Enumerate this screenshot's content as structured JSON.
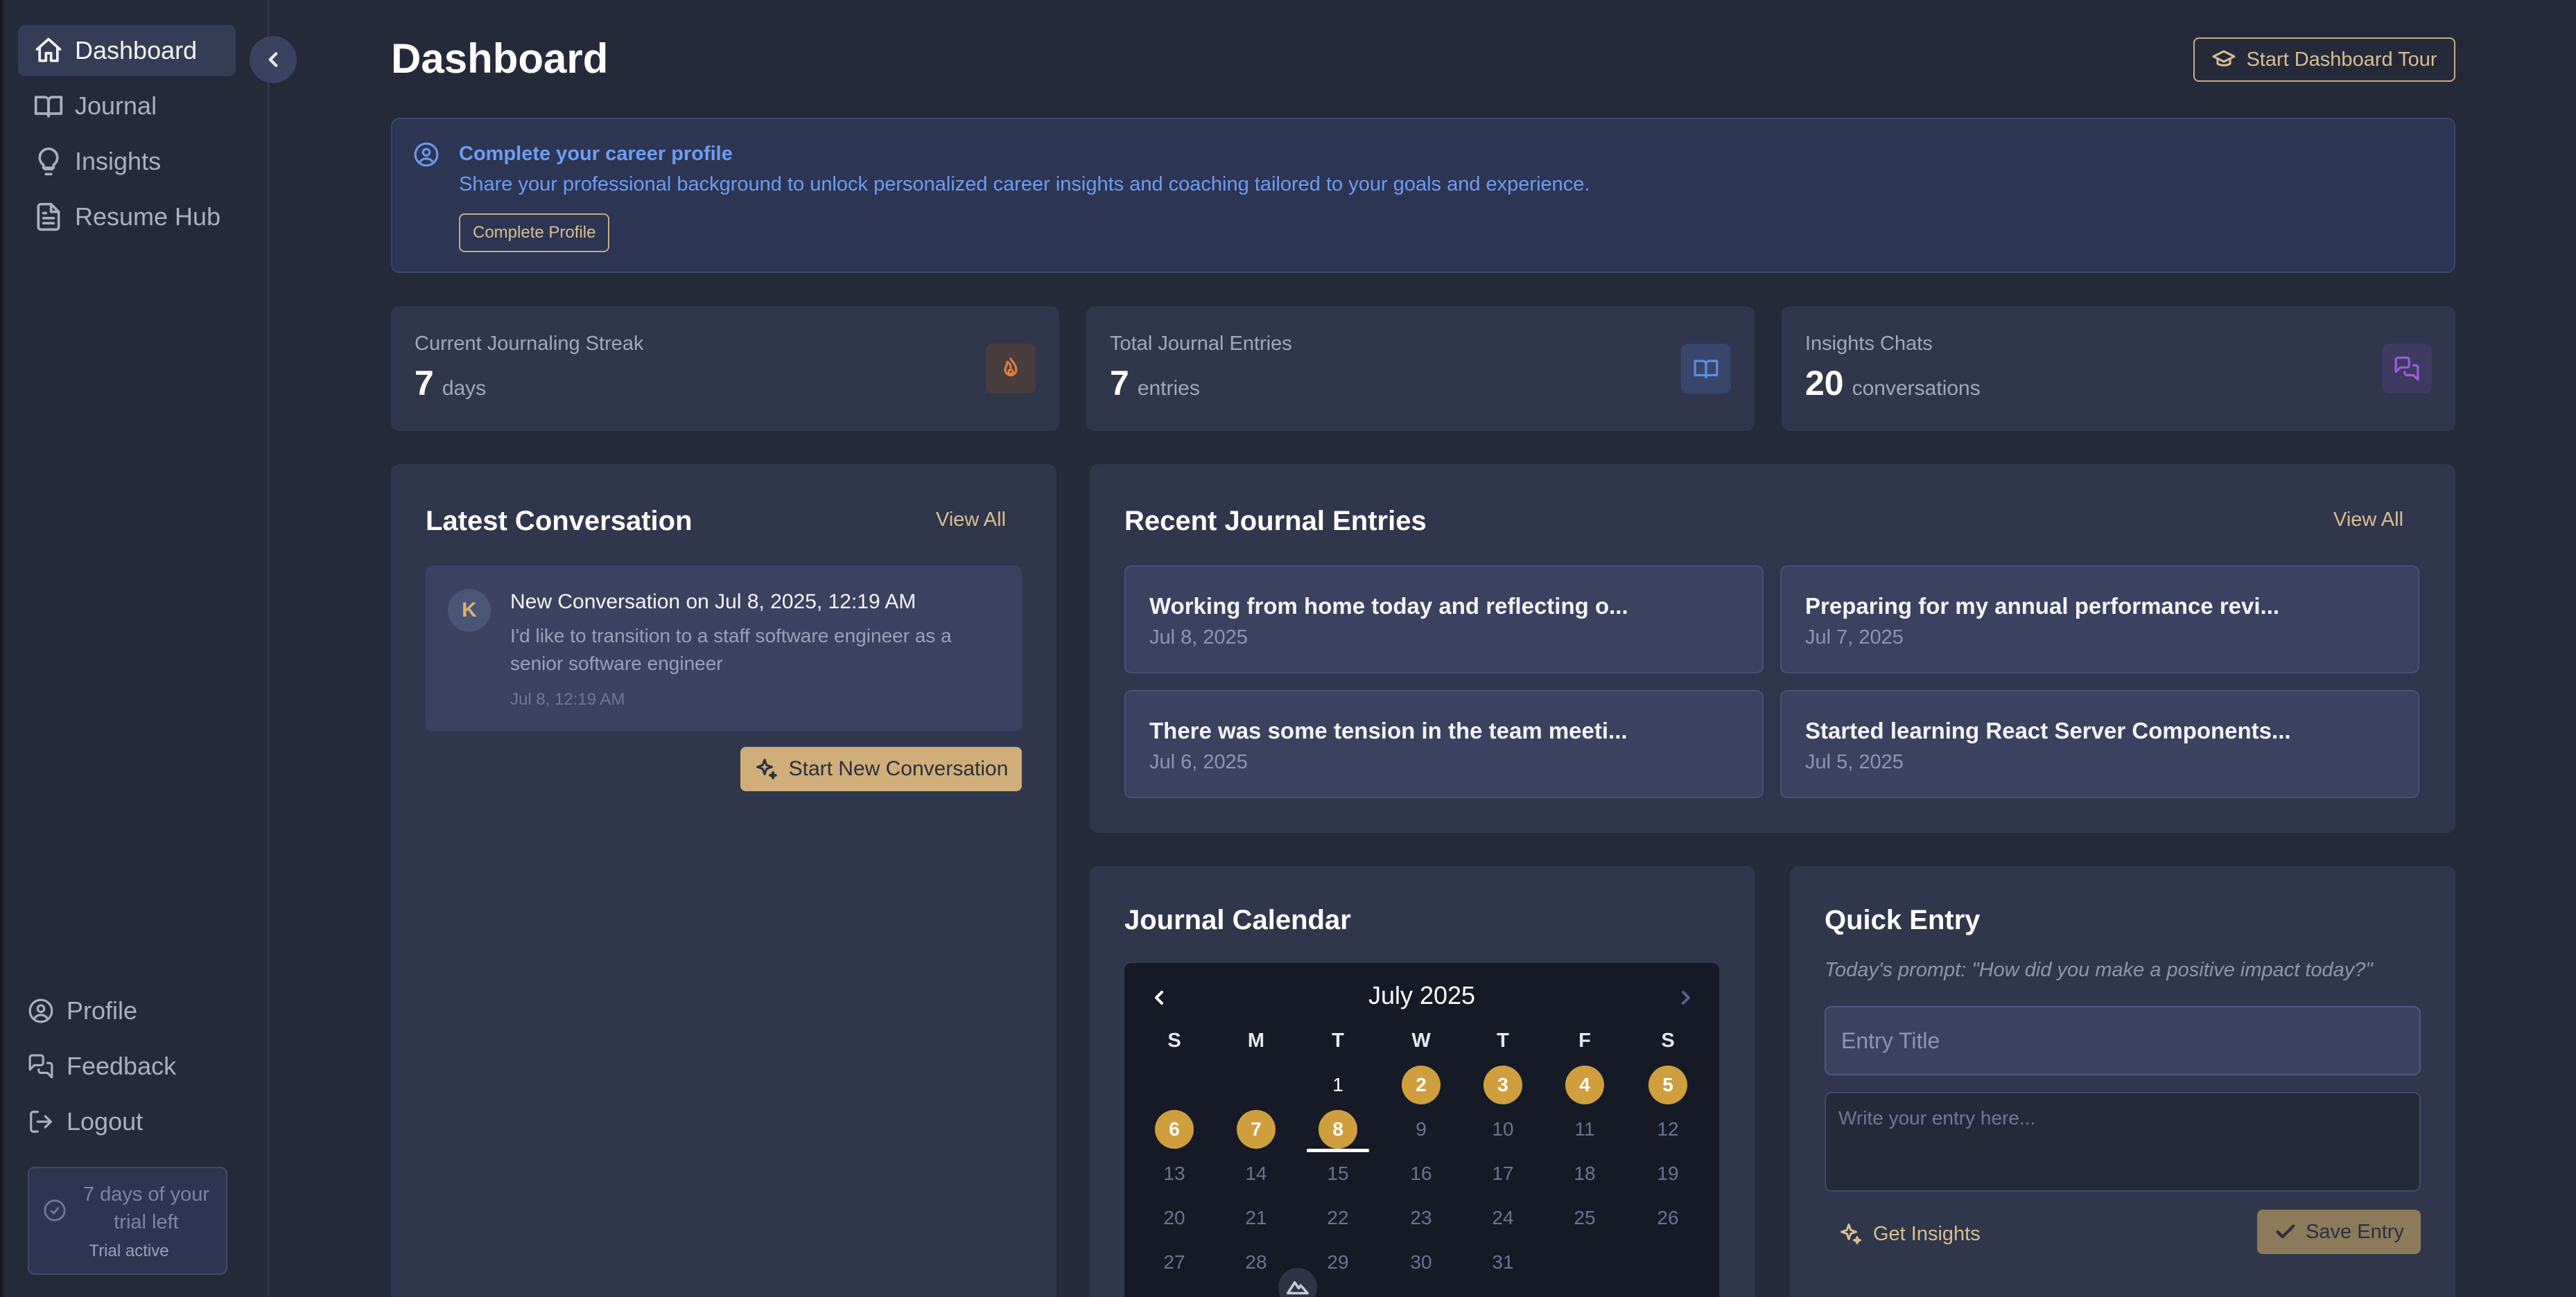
{
  "sidebar": {
    "nav": [
      {
        "label": "Dashboard",
        "icon": "home-icon",
        "active": true
      },
      {
        "label": "Journal",
        "icon": "book-icon",
        "active": false
      },
      {
        "label": "Insights",
        "icon": "lightbulb-icon",
        "active": false
      },
      {
        "label": "Resume Hub",
        "icon": "document-icon",
        "active": false
      }
    ],
    "bottom": [
      {
        "label": "Profile",
        "icon": "user-circle-icon"
      },
      {
        "label": "Feedback",
        "icon": "chat-bubbles-icon"
      },
      {
        "label": "Logout",
        "icon": "logout-icon"
      }
    ],
    "trial": {
      "text": "7 days of your trial left",
      "status": "Trial active"
    }
  },
  "header": {
    "title": "Dashboard",
    "tour_button": "Start Dashboard Tour"
  },
  "banner": {
    "title": "Complete your career profile",
    "description": "Share your professional background to unlock personalized career insights and coaching tailored to your goals and experience.",
    "button": "Complete Profile"
  },
  "stats": [
    {
      "label": "Current Journaling Streak",
      "value": "7",
      "unit": "days",
      "icon": "flame-icon",
      "color": "#e0803b",
      "bg": "#4a3d3e"
    },
    {
      "label": "Total Journal Entries",
      "value": "7",
      "unit": "entries",
      "icon": "book-icon",
      "color": "#5b8fe6",
      "bg": "#37466a"
    },
    {
      "label": "Insights Chats",
      "value": "20",
      "unit": "conversations",
      "icon": "chat-bubbles-icon",
      "color": "#a05ce0",
      "bg": "#3f3a60"
    }
  ],
  "latest_conversation": {
    "title": "Latest Conversation",
    "view_all": "View All",
    "avatar_letter": "K",
    "item": {
      "title": "New Conversation on Jul 8, 2025, 12:19 AM",
      "message": "I'd like to transition to a staff software engineer as a senior software engineer",
      "time": "Jul 8, 12:19 AM"
    },
    "new_button": "Start New Conversation"
  },
  "recent_entries": {
    "title": "Recent Journal Entries",
    "view_all": "View All",
    "entries": [
      {
        "title": "Working from home today and reflecting o...",
        "date": "Jul 8, 2025"
      },
      {
        "title": "Preparing for my annual performance revi...",
        "date": "Jul 7, 2025"
      },
      {
        "title": "There was some tension in the team meeti...",
        "date": "Jul 6, 2025"
      },
      {
        "title": "Started learning React Server Components...",
        "date": "Jul 5, 2025"
      }
    ]
  },
  "calendar": {
    "title": "Journal Calendar",
    "month": "July 2025",
    "weekdays": [
      "S",
      "M",
      "T",
      "W",
      "T",
      "F",
      "S"
    ],
    "first_weekday": 2,
    "days_in_month": 31,
    "entry_days": [
      2,
      3,
      4,
      5,
      6,
      7,
      8
    ],
    "today": 8,
    "accent": "#cf9f3e"
  },
  "quick_entry": {
    "title": "Quick Entry",
    "prompt": "Today's prompt: \"How did you make a positive impact today?\"",
    "title_placeholder": "Entry Title",
    "body_placeholder": "Write your entry here...",
    "insights_button": "Get Insights",
    "save_button": "Save Entry"
  }
}
